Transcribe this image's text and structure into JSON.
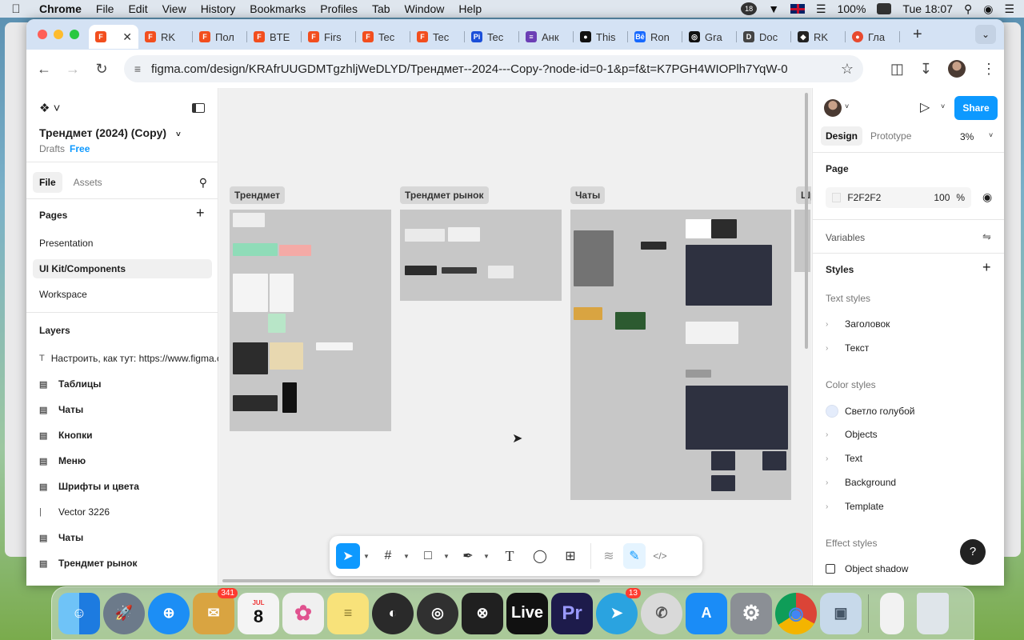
{
  "menubar": {
    "app_name": "Chrome",
    "items": [
      "File",
      "Edit",
      "View",
      "History",
      "Bookmarks",
      "Profiles",
      "Tab",
      "Window",
      "Help"
    ],
    "battery": "100%",
    "clock": "Tue 18:07",
    "notif_count": "18"
  },
  "browser": {
    "tabs": [
      {
        "label": "",
        "active": true,
        "fav": "F",
        "color": "#f24e1e"
      },
      {
        "label": "RK",
        "fav": "F",
        "color": "#f24e1e"
      },
      {
        "label": "Пол",
        "fav": "F",
        "color": "#f24e1e"
      },
      {
        "label": "BTE",
        "fav": "F",
        "color": "#f24e1e"
      },
      {
        "label": "Firs",
        "fav": "F",
        "color": "#f24e1e"
      },
      {
        "label": "Tec",
        "fav": "F",
        "color": "#f24e1e"
      },
      {
        "label": "Tec",
        "fav": "F",
        "color": "#f24e1e"
      },
      {
        "label": "Tec",
        "fav": "Pi",
        "color": "#1b4fd9"
      },
      {
        "label": "Анк",
        "fav": "≡",
        "color": "#6c3fb5"
      },
      {
        "label": "This",
        "fav": "●",
        "color": "#111"
      },
      {
        "label": "Ron",
        "fav": "Bē",
        "color": "#1769ff"
      },
      {
        "label": "Gra",
        "fav": "◎",
        "color": "#111"
      },
      {
        "label": "Doc",
        "fav": "D",
        "color": "#444"
      },
      {
        "label": "RK",
        "fav": "◆",
        "color": "#222"
      },
      {
        "label": "Гла",
        "fav": "●",
        "color": "#e84a2f"
      }
    ],
    "url": "figma.com/design/KRAfrUUGDMTgzhljWeDLYD/Трендмет--2024---Copy-?node-id=0-1&p=f&t=K7PGH4WIOPlh7YqW-0"
  },
  "figma": {
    "file_title": "Трендмет (2024) (Copy)",
    "drafts_label": "Drafts",
    "plan_label": "Free",
    "file_tab": "File",
    "assets_tab": "Assets",
    "pages_heading": "Pages",
    "pages": [
      "Presentation",
      "UI Kit/Components",
      "Workspace"
    ],
    "active_page_index": 1,
    "layers_heading": "Layers",
    "layers": [
      {
        "label": "Настроить, как тут: https://www.figma.com",
        "icon": "T",
        "bold": false
      },
      {
        "label": "Таблицы",
        "icon": "▤",
        "bold": true
      },
      {
        "label": "Чаты",
        "icon": "▤",
        "bold": true
      },
      {
        "label": "Кнопки",
        "icon": "▤",
        "bold": true
      },
      {
        "label": "Меню",
        "icon": "▤",
        "bold": true
      },
      {
        "label": "Шрифты и цвета",
        "icon": "▤",
        "bold": true
      },
      {
        "label": "Vector 3226",
        "icon": "|",
        "bold": false
      },
      {
        "label": "Чаты",
        "icon": "▤",
        "bold": true
      },
      {
        "label": "Трендмет рынок",
        "icon": "▤",
        "bold": true
      }
    ],
    "canvas_frames": [
      "Трендмет",
      "Трендмет рынок",
      "Чаты",
      "Шр"
    ],
    "share_label": "Share",
    "design_tab": "Design",
    "prototype_tab": "Prototype",
    "zoom": "3%",
    "page_section": "Page",
    "page_color": "F2F2F2",
    "page_opacity": "100",
    "percent_sign": "%",
    "variables_label": "Variables",
    "styles_label": "Styles",
    "text_styles_label": "Text styles",
    "text_styles": [
      "Заголовок",
      "Текст"
    ],
    "color_styles_label": "Color styles",
    "color_styles": [
      "Светло голубой",
      "Objects",
      "Text",
      "Background",
      "Template"
    ],
    "effect_styles_label": "Effect styles",
    "effect_style": "Object shadow",
    "help": "?"
  },
  "dock": {
    "apps": [
      {
        "name": "Finder",
        "icon": "☺",
        "color": "#3b8fe0"
      },
      {
        "name": "Launchpad",
        "icon": "🚀",
        "color": "#6c7a8a"
      },
      {
        "name": "Safari",
        "icon": "⊕",
        "color": "#1c8ef5"
      },
      {
        "name": "Mail",
        "icon": "✉",
        "color": "#d9a441",
        "badge": "341"
      },
      {
        "name": "Calendar",
        "icon": "8",
        "color": "#f4f4f4",
        "month": "JUL"
      },
      {
        "name": "Photos",
        "icon": "✿",
        "color": "#f0f0f0"
      },
      {
        "name": "Notes",
        "icon": "≡",
        "color": "#f8e27a"
      },
      {
        "name": "Pika",
        "icon": "◐",
        "color": "#2a2a2a"
      },
      {
        "name": "OBS",
        "icon": "◎",
        "color": "#303030"
      },
      {
        "name": "Resolve",
        "icon": "⊗",
        "color": "#202020"
      },
      {
        "name": "Live",
        "icon": "Live",
        "color": "#111"
      },
      {
        "name": "Premiere",
        "icon": "Pr",
        "color": "#1d1b4b"
      },
      {
        "name": "Telegram",
        "icon": "➤",
        "color": "#2aa3e0",
        "badge": "13"
      },
      {
        "name": "WhatsApp",
        "icon": "✆",
        "color": "#d9d9d9"
      },
      {
        "name": "App Store",
        "icon": "A",
        "color": "#1a8cf7"
      },
      {
        "name": "Settings",
        "icon": "⚙",
        "color": "#8b8f95"
      },
      {
        "name": "Chrome",
        "icon": "◉",
        "color": "#f4f4f4"
      },
      {
        "name": "Preview",
        "icon": "▣",
        "color": "#c7d9ea"
      }
    ]
  }
}
